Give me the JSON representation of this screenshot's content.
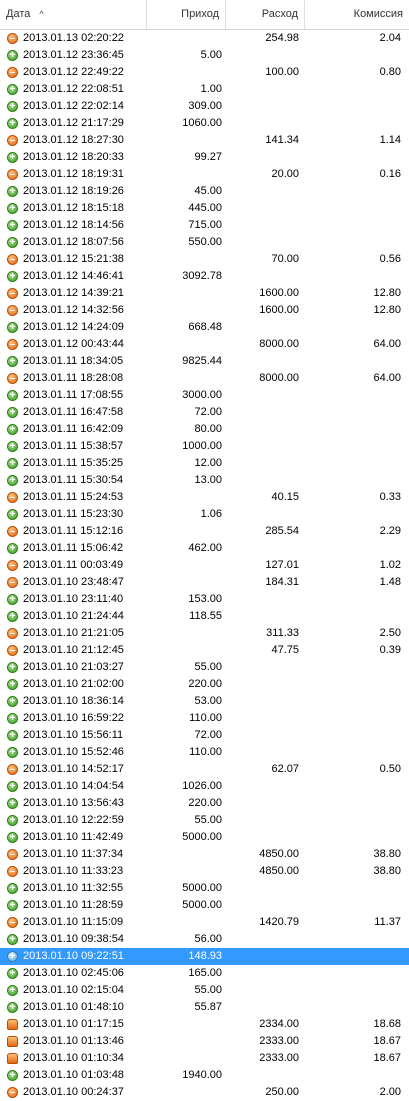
{
  "columns": {
    "date": "Дата",
    "income": "Приход",
    "expense": "Расход",
    "fee": "Комиссия"
  },
  "sort_arrow": "^",
  "rows": [
    {
      "type": "out",
      "date": "2013.01.13 02:20:22",
      "in": "",
      "out": "254.98",
      "fee": "2.04"
    },
    {
      "type": "in",
      "date": "2013.01.12 23:36:45",
      "in": "5.00",
      "out": "",
      "fee": ""
    },
    {
      "type": "out",
      "date": "2013.01.12 22:49:22",
      "in": "",
      "out": "100.00",
      "fee": "0.80"
    },
    {
      "type": "in",
      "date": "2013.01.12 22:08:51",
      "in": "1.00",
      "out": "",
      "fee": ""
    },
    {
      "type": "in",
      "date": "2013.01.12 22:02:14",
      "in": "309.00",
      "out": "",
      "fee": ""
    },
    {
      "type": "in",
      "date": "2013.01.12 21:17:29",
      "in": "1060.00",
      "out": "",
      "fee": ""
    },
    {
      "type": "out",
      "date": "2013.01.12 18:27:30",
      "in": "",
      "out": "141.34",
      "fee": "1.14"
    },
    {
      "type": "in",
      "date": "2013.01.12 18:20:33",
      "in": "99.27",
      "out": "",
      "fee": ""
    },
    {
      "type": "out",
      "date": "2013.01.12 18:19:31",
      "in": "",
      "out": "20.00",
      "fee": "0.16"
    },
    {
      "type": "in",
      "date": "2013.01.12 18:19:26",
      "in": "45.00",
      "out": "",
      "fee": ""
    },
    {
      "type": "in",
      "date": "2013.01.12 18:15:18",
      "in": "445.00",
      "out": "",
      "fee": ""
    },
    {
      "type": "in",
      "date": "2013.01.12 18:14:56",
      "in": "715.00",
      "out": "",
      "fee": ""
    },
    {
      "type": "in",
      "date": "2013.01.12 18:07:56",
      "in": "550.00",
      "out": "",
      "fee": ""
    },
    {
      "type": "out",
      "date": "2013.01.12 15:21:38",
      "in": "",
      "out": "70.00",
      "fee": "0.56"
    },
    {
      "type": "in",
      "date": "2013.01.12 14:46:41",
      "in": "3092.78",
      "out": "",
      "fee": ""
    },
    {
      "type": "out",
      "date": "2013.01.12 14:39:21",
      "in": "",
      "out": "1600.00",
      "fee": "12.80"
    },
    {
      "type": "out",
      "date": "2013.01.12 14:32:56",
      "in": "",
      "out": "1600.00",
      "fee": "12.80"
    },
    {
      "type": "in",
      "date": "2013.01.12 14:24:09",
      "in": "668.48",
      "out": "",
      "fee": ""
    },
    {
      "type": "out",
      "date": "2013.01.12 00:43:44",
      "in": "",
      "out": "8000.00",
      "fee": "64.00"
    },
    {
      "type": "in",
      "date": "2013.01.11 18:34:05",
      "in": "9825.44",
      "out": "",
      "fee": ""
    },
    {
      "type": "out",
      "date": "2013.01.11 18:28:08",
      "in": "",
      "out": "8000.00",
      "fee": "64.00"
    },
    {
      "type": "in",
      "date": "2013.01.11 17:08:55",
      "in": "3000.00",
      "out": "",
      "fee": ""
    },
    {
      "type": "in",
      "date": "2013.01.11 16:47:58",
      "in": "72.00",
      "out": "",
      "fee": ""
    },
    {
      "type": "in",
      "date": "2013.01.11 16:42:09",
      "in": "80.00",
      "out": "",
      "fee": ""
    },
    {
      "type": "in",
      "date": "2013.01.11 15:38:57",
      "in": "1000.00",
      "out": "",
      "fee": ""
    },
    {
      "type": "in",
      "date": "2013.01.11 15:35:25",
      "in": "12.00",
      "out": "",
      "fee": ""
    },
    {
      "type": "in",
      "date": "2013.01.11 15:30:54",
      "in": "13.00",
      "out": "",
      "fee": ""
    },
    {
      "type": "out",
      "date": "2013.01.11 15:24:53",
      "in": "",
      "out": "40.15",
      "fee": "0.33"
    },
    {
      "type": "in",
      "date": "2013.01.11 15:23:30",
      "in": "1.06",
      "out": "",
      "fee": ""
    },
    {
      "type": "out",
      "date": "2013.01.11 15:12:16",
      "in": "",
      "out": "285.54",
      "fee": "2.29"
    },
    {
      "type": "in",
      "date": "2013.01.11 15:06:42",
      "in": "462.00",
      "out": "",
      "fee": ""
    },
    {
      "type": "out",
      "date": "2013.01.11 00:03:49",
      "in": "",
      "out": "127.01",
      "fee": "1.02"
    },
    {
      "type": "out",
      "date": "2013.01.10 23:48:47",
      "in": "",
      "out": "184.31",
      "fee": "1.48"
    },
    {
      "type": "in",
      "date": "2013.01.10 23:11:40",
      "in": "153.00",
      "out": "",
      "fee": ""
    },
    {
      "type": "in",
      "date": "2013.01.10 21:24:44",
      "in": "118.55",
      "out": "",
      "fee": ""
    },
    {
      "type": "out",
      "date": "2013.01.10 21:21:05",
      "in": "",
      "out": "311.33",
      "fee": "2.50"
    },
    {
      "type": "out",
      "date": "2013.01.10 21:12:45",
      "in": "",
      "out": "47.75",
      "fee": "0.39"
    },
    {
      "type": "in",
      "date": "2013.01.10 21:03:27",
      "in": "55.00",
      "out": "",
      "fee": ""
    },
    {
      "type": "in",
      "date": "2013.01.10 21:02:00",
      "in": "220.00",
      "out": "",
      "fee": ""
    },
    {
      "type": "in",
      "date": "2013.01.10 18:36:14",
      "in": "53.00",
      "out": "",
      "fee": ""
    },
    {
      "type": "in",
      "date": "2013.01.10 16:59:22",
      "in": "110.00",
      "out": "",
      "fee": ""
    },
    {
      "type": "in",
      "date": "2013.01.10 15:56:11",
      "in": "72.00",
      "out": "",
      "fee": ""
    },
    {
      "type": "in",
      "date": "2013.01.10 15:52:46",
      "in": "110.00",
      "out": "",
      "fee": ""
    },
    {
      "type": "out",
      "date": "2013.01.10 14:52:17",
      "in": "",
      "out": "62.07",
      "fee": "0.50"
    },
    {
      "type": "in",
      "date": "2013.01.10 14:04:54",
      "in": "1026.00",
      "out": "",
      "fee": ""
    },
    {
      "type": "in",
      "date": "2013.01.10 13:56:43",
      "in": "220.00",
      "out": "",
      "fee": ""
    },
    {
      "type": "in",
      "date": "2013.01.10 12:22:59",
      "in": "55.00",
      "out": "",
      "fee": ""
    },
    {
      "type": "in",
      "date": "2013.01.10 11:42:49",
      "in": "5000.00",
      "out": "",
      "fee": ""
    },
    {
      "type": "out",
      "date": "2013.01.10 11:37:34",
      "in": "",
      "out": "4850.00",
      "fee": "38.80"
    },
    {
      "type": "out",
      "date": "2013.01.10 11:33:23",
      "in": "",
      "out": "4850.00",
      "fee": "38.80"
    },
    {
      "type": "in",
      "date": "2013.01.10 11:32:55",
      "in": "5000.00",
      "out": "",
      "fee": ""
    },
    {
      "type": "in",
      "date": "2013.01.10 11:28:59",
      "in": "5000.00",
      "out": "",
      "fee": ""
    },
    {
      "type": "out",
      "date": "2013.01.10 11:15:09",
      "in": "",
      "out": "1420.79",
      "fee": "11.37"
    },
    {
      "type": "in",
      "date": "2013.01.10 09:38:54",
      "in": "56.00",
      "out": "",
      "fee": ""
    },
    {
      "type": "in",
      "date": "2013.01.10 09:22:51",
      "in": "148.93",
      "out": "",
      "fee": "",
      "selected": true
    },
    {
      "type": "in",
      "date": "2013.01.10 02:45:06",
      "in": "165.00",
      "out": "",
      "fee": ""
    },
    {
      "type": "in",
      "date": "2013.01.10 02:15:04",
      "in": "55.00",
      "out": "",
      "fee": ""
    },
    {
      "type": "in",
      "date": "2013.01.10 01:48:10",
      "in": "55.87",
      "out": "",
      "fee": ""
    },
    {
      "type": "lock",
      "date": "2013.01.10 01:17:15",
      "in": "",
      "out": "2334.00",
      "fee": "18.68"
    },
    {
      "type": "lock",
      "date": "2013.01.10 01:13:46",
      "in": "",
      "out": "2333.00",
      "fee": "18.67"
    },
    {
      "type": "lock",
      "date": "2013.01.10 01:10:34",
      "in": "",
      "out": "2333.00",
      "fee": "18.67"
    },
    {
      "type": "in",
      "date": "2013.01.10 01:03:48",
      "in": "1940.00",
      "out": "",
      "fee": ""
    },
    {
      "type": "out",
      "date": "2013.01.10 00:24:37",
      "in": "",
      "out": "250.00",
      "fee": "2.00"
    }
  ],
  "icons": {
    "in": "income-plus-icon",
    "out": "expense-minus-icon",
    "lock": "locked-expense-icon"
  },
  "colors": {
    "selection": "#3399ff",
    "income_icon": "#3a9a1e",
    "expense_icon": "#e0670f"
  }
}
